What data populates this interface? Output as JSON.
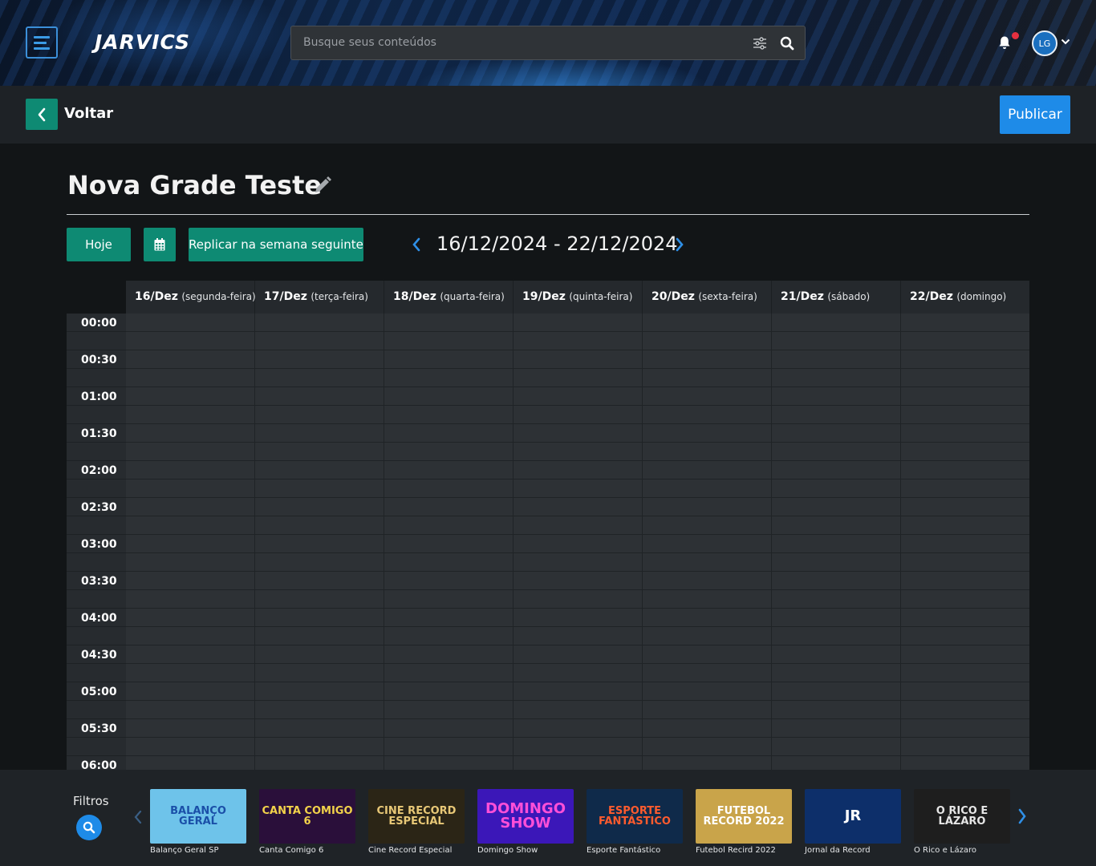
{
  "header": {
    "logo": "JARVICS",
    "search_placeholder": "Busque seus conteúdos",
    "avatar_initials": "LG"
  },
  "subbar": {
    "back_label": "Voltar",
    "publish_label": "Publicar"
  },
  "page": {
    "title": "Nova Grade Teste"
  },
  "toolbar": {
    "today_label": "Hoje",
    "replicate_label": "Replicar na semana seguinte",
    "week_range": "16/12/2024 - 22/12/2024"
  },
  "days": [
    {
      "date": "16/Dez",
      "weekday": "(segunda-feira)"
    },
    {
      "date": "17/Dez",
      "weekday": "(terça-feira)"
    },
    {
      "date": "18/Dez",
      "weekday": "(quarta-feira)"
    },
    {
      "date": "19/Dez",
      "weekday": "(quinta-feira)"
    },
    {
      "date": "20/Dez",
      "weekday": "(sexta-feira)"
    },
    {
      "date": "21/Dez",
      "weekday": "(sábado)"
    },
    {
      "date": "22/Dez",
      "weekday": "(domingo)"
    }
  ],
  "times": [
    "00:00",
    "00:30",
    "01:00",
    "01:30",
    "02:00",
    "02:30",
    "03:00",
    "03:30",
    "04:00",
    "04:30",
    "05:00",
    "05:30",
    "06:00"
  ],
  "bottom": {
    "filters_label": "Filtros",
    "programs": [
      {
        "label": "Balanço Geral SP",
        "thumb_text": "BALANÇO GERAL",
        "bg": "#6ec3ea",
        "fg": "#1a4fa8"
      },
      {
        "label": "Canta Comigo 6",
        "thumb_text": "CANTA COMIGO 6",
        "bg": "#2a0f3a",
        "fg": "#f2d24a"
      },
      {
        "label": "Cine Record Especial",
        "thumb_text": "CINE RECORD ESPECIAL",
        "bg": "#2b2516",
        "fg": "#e8c877"
      },
      {
        "label": "Domingo Show",
        "thumb_text": "DOMINGO SHOW",
        "bg": "#3b17b8",
        "fg": "#ff4fd8"
      },
      {
        "label": "Esporte Fantástico",
        "thumb_text": "ESPORTE FANTÁSTICO",
        "bg": "#0f2a4a",
        "fg": "#ff5b2e"
      },
      {
        "label": "Futebol Recird 2022",
        "thumb_text": "FUTEBOL RECORD 2022",
        "bg": "#c9a44a",
        "fg": "#ffffff"
      },
      {
        "label": "Jornal da Record",
        "thumb_text": "JR",
        "bg": "#0d2f6a",
        "fg": "#ffffff"
      },
      {
        "label": "O Rico e Lázaro",
        "thumb_text": "O RICO E LÁZARO",
        "bg": "#1e1e1e",
        "fg": "#e6e6e6"
      }
    ]
  }
}
